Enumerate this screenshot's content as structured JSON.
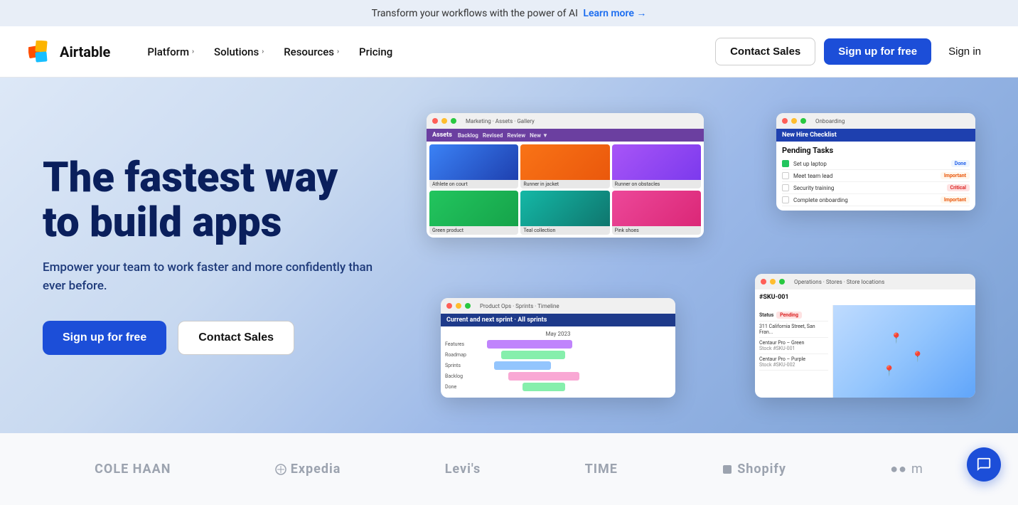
{
  "banner": {
    "text": "Transform your workflows with the power of AI",
    "link_text": "Learn more →"
  },
  "navbar": {
    "logo_text": "Airtable",
    "nav_items": [
      {
        "label": "Platform",
        "has_chevron": true
      },
      {
        "label": "Solutions",
        "has_chevron": true
      },
      {
        "label": "Resources",
        "has_chevron": true
      },
      {
        "label": "Pricing",
        "has_chevron": false
      }
    ],
    "contact_sales": "Contact Sales",
    "sign_up": "Sign up for free",
    "sign_in": "Sign in"
  },
  "hero": {
    "title_line1": "The fastest way",
    "title_line2": "to build apps",
    "subtitle": "Empower your team to work faster and more confidently than ever before.",
    "btn_primary": "Sign up for free",
    "btn_secondary": "Contact Sales"
  },
  "logos": [
    {
      "name": "COLE HAAN"
    },
    {
      "name": "Expedia"
    },
    {
      "name": "Levi's"
    },
    {
      "name": "TIME"
    },
    {
      "name": "Shopify"
    },
    {
      "name": "●●m"
    }
  ],
  "chat_button": {
    "label": "Chat"
  }
}
